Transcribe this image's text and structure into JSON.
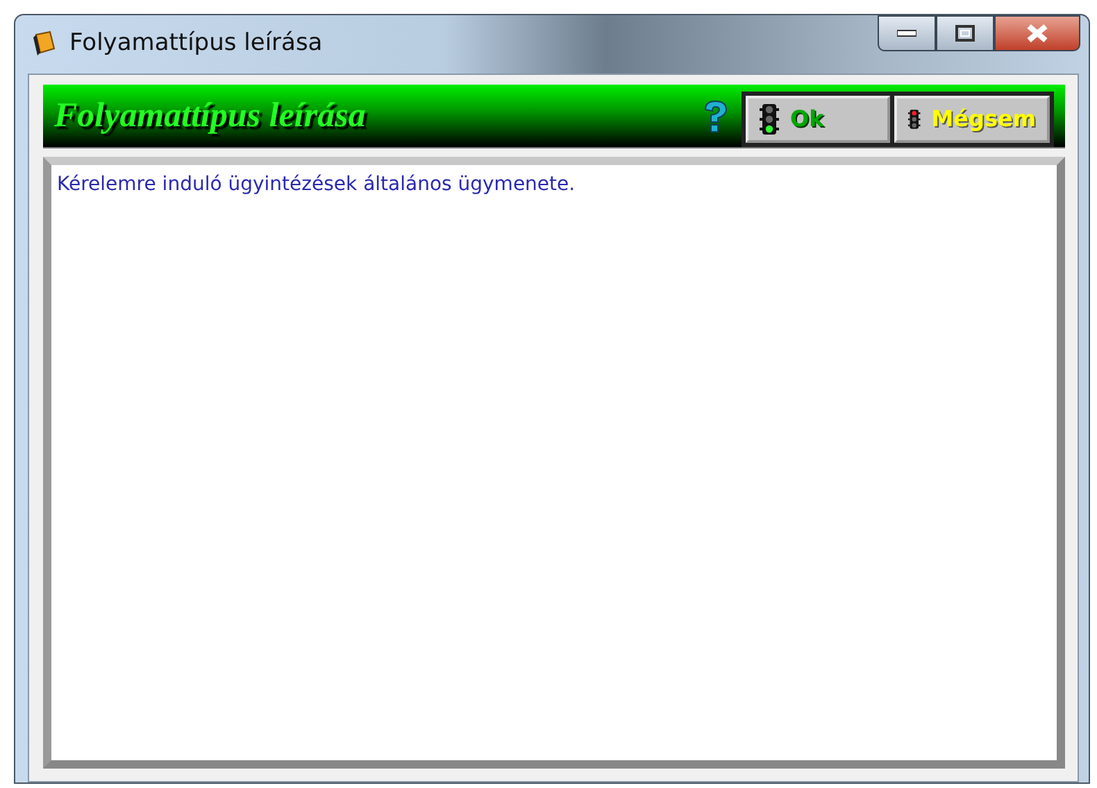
{
  "window": {
    "title": "Folyamattípus leírása"
  },
  "header": {
    "title": "Folyamattípus leírása"
  },
  "buttons": [
    {
      "label": "Ok",
      "kind": "ok"
    },
    {
      "label": "Mégsem",
      "kind": "cancel"
    }
  ],
  "description": {
    "value": "Kérelemre induló ügyintézések általános ügymenete."
  }
}
